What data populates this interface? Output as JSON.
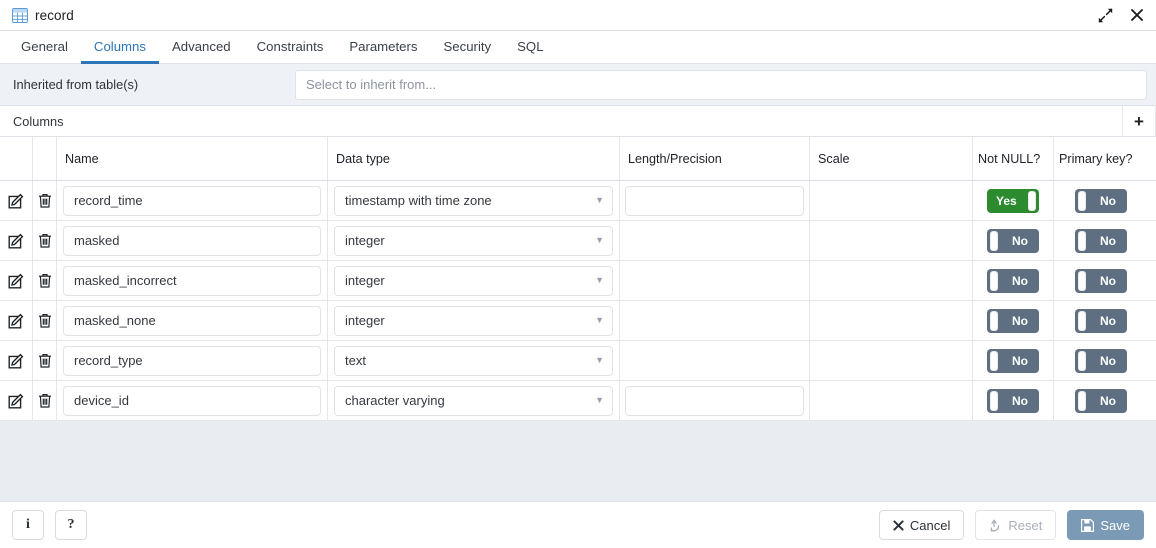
{
  "window": {
    "title": "record",
    "title_icon": "table-icon",
    "expand_icon": "expand-arrows-icon",
    "close_icon": "close-x-icon"
  },
  "tabs": [
    {
      "label": "General",
      "active": false
    },
    {
      "label": "Columns",
      "active": true
    },
    {
      "label": "Advanced",
      "active": false
    },
    {
      "label": "Constraints",
      "active": false
    },
    {
      "label": "Parameters",
      "active": false
    },
    {
      "label": "Security",
      "active": false
    },
    {
      "label": "SQL",
      "active": false
    }
  ],
  "inherited": {
    "label": "Inherited from table(s)",
    "placeholder": "Select to inherit from...",
    "value": ""
  },
  "columns_panel": {
    "title": "Columns",
    "add_label": "+",
    "add_icon": "plus-icon",
    "headers": {
      "edit": "",
      "delete": "",
      "name": "Name",
      "data_type": "Data type",
      "length_precision": "Length/Precision",
      "scale": "Scale",
      "not_null": "Not NULL?",
      "primary_key": "Primary key?"
    },
    "rows": [
      {
        "name": "record_time",
        "data_type": "timestamp with time zone",
        "length": "",
        "has_length_input": true,
        "scale": "",
        "has_scale_input": false,
        "not_null": "Yes",
        "not_null_on": true,
        "primary_key": "No",
        "primary_key_on": false
      },
      {
        "name": "masked",
        "data_type": "integer",
        "length": "",
        "has_length_input": false,
        "scale": "",
        "has_scale_input": false,
        "not_null": "No",
        "not_null_on": false,
        "primary_key": "No",
        "primary_key_on": false
      },
      {
        "name": "masked_incorrect",
        "data_type": "integer",
        "length": "",
        "has_length_input": false,
        "scale": "",
        "has_scale_input": false,
        "not_null": "No",
        "not_null_on": false,
        "primary_key": "No",
        "primary_key_on": false
      },
      {
        "name": "masked_none",
        "data_type": "integer",
        "length": "",
        "has_length_input": false,
        "scale": "",
        "has_scale_input": false,
        "not_null": "No",
        "not_null_on": false,
        "primary_key": "No",
        "primary_key_on": false
      },
      {
        "name": "record_type",
        "data_type": "text",
        "length": "",
        "has_length_input": false,
        "scale": "",
        "has_scale_input": false,
        "not_null": "No",
        "not_null_on": false,
        "primary_key": "No",
        "primary_key_on": false
      },
      {
        "name": "device_id",
        "data_type": "character varying",
        "length": "",
        "has_length_input": true,
        "scale": "",
        "has_scale_input": false,
        "not_null": "No",
        "not_null_on": false,
        "primary_key": "No",
        "primary_key_on": false
      }
    ],
    "row_icons": {
      "edit": "edit-pencil-icon",
      "delete": "trash-icon"
    }
  },
  "footer": {
    "info_label": "i",
    "help_label": "?",
    "cancel_label": "Cancel",
    "reset_label": "Reset",
    "save_label": "Save",
    "cancel_icon": "x-icon",
    "reset_icon": "recycle-icon",
    "save_icon": "floppy-disk-icon"
  },
  "colors": {
    "accent": "#2c76b8",
    "toggle_on": "#2c8b2f",
    "toggle_off": "#5d6f80",
    "save_button": "#7a9ab5",
    "panel_bg": "#e9edf2"
  }
}
